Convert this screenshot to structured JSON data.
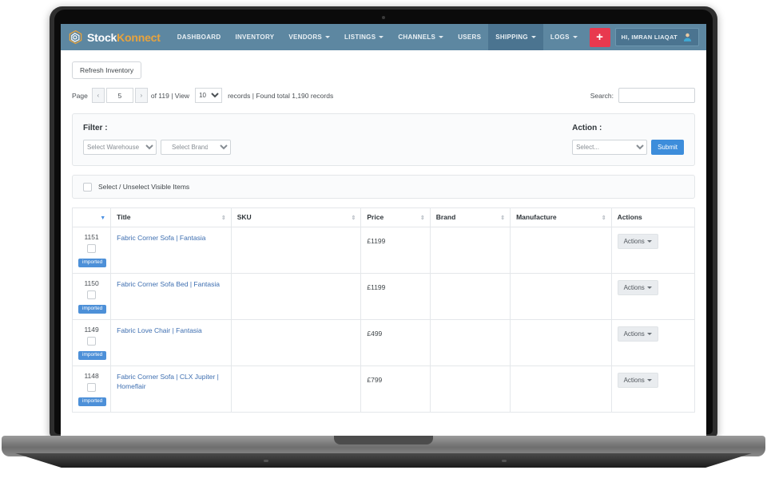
{
  "brand": {
    "name_part1": "Stock",
    "name_part2": "Konnect",
    "logo_icon": "hexagon-logo-icon"
  },
  "nav": {
    "items": [
      {
        "label": "DASHBOARD",
        "has_caret": false,
        "active": false
      },
      {
        "label": "INVENTORY",
        "has_caret": false,
        "active": false
      },
      {
        "label": "VENDORS",
        "has_caret": true,
        "active": false
      },
      {
        "label": "LISTINGS",
        "has_caret": true,
        "active": false
      },
      {
        "label": "CHANNELS",
        "has_caret": true,
        "active": false
      },
      {
        "label": "USERS",
        "has_caret": false,
        "active": false
      },
      {
        "label": "SHIPPING",
        "has_caret": true,
        "active": true
      },
      {
        "label": "LOGS",
        "has_caret": true,
        "active": false
      }
    ],
    "add_button_label": "+",
    "user_label": "HI, IMRAN LIAQAT",
    "navbar_color": "#5d87a1",
    "active_color": "#4b7490",
    "add_button_color": "#e8394f",
    "brand_accent": "#e8a33d"
  },
  "toolbar": {
    "refresh_label": "Refresh Inventory",
    "page_label": "Page",
    "prev_label": "‹",
    "next_label": "›",
    "page_value": "5",
    "of_text": "of 119 | View",
    "view_value": "10",
    "records_text": "records | Found total 1,190 records",
    "search_label": "Search:",
    "search_value": ""
  },
  "filter_panel": {
    "filter_title": "Filter :",
    "warehouse_value": "Select Warehouse",
    "brand_value": "Select Brand",
    "action_title": "Action :",
    "action_value": "Select...",
    "submit_label": "Submit",
    "submit_color": "#3d8ddb"
  },
  "select_bar": {
    "label": "Select / Unselect Visible Items",
    "checked": false
  },
  "table": {
    "columns": [
      {
        "label": "",
        "sort": "desc"
      },
      {
        "label": "Title",
        "sort": "both"
      },
      {
        "label": "SKU",
        "sort": "both"
      },
      {
        "label": "Price",
        "sort": "both"
      },
      {
        "label": "Brand",
        "sort": "both"
      },
      {
        "label": "Manufacture",
        "sort": "both"
      },
      {
        "label": "Actions",
        "sort": "none"
      }
    ],
    "action_button_label": "Actions",
    "badge_label": "imported",
    "badge_color": "#4d90d8",
    "rows": [
      {
        "id": "1151",
        "title": "Fabric Corner Sofa | Fantasia",
        "sku": "",
        "price": "£1199",
        "brand": "",
        "manufacture": "",
        "badge": "imported"
      },
      {
        "id": "1150",
        "title": "Fabric Corner Sofa Bed | Fantasia",
        "sku": "",
        "price": "£1199",
        "brand": "",
        "manufacture": "",
        "badge": "imported"
      },
      {
        "id": "1149",
        "title": "Fabric Love Chair | Fantasia",
        "sku": "",
        "price": "£499",
        "brand": "",
        "manufacture": "",
        "badge": "imported"
      },
      {
        "id": "1148",
        "title": "Fabric Corner Sofa | CLX Jupiter | Homeflair",
        "sku": "",
        "price": "£799",
        "brand": "",
        "manufacture": "",
        "badge": "imported"
      }
    ]
  }
}
